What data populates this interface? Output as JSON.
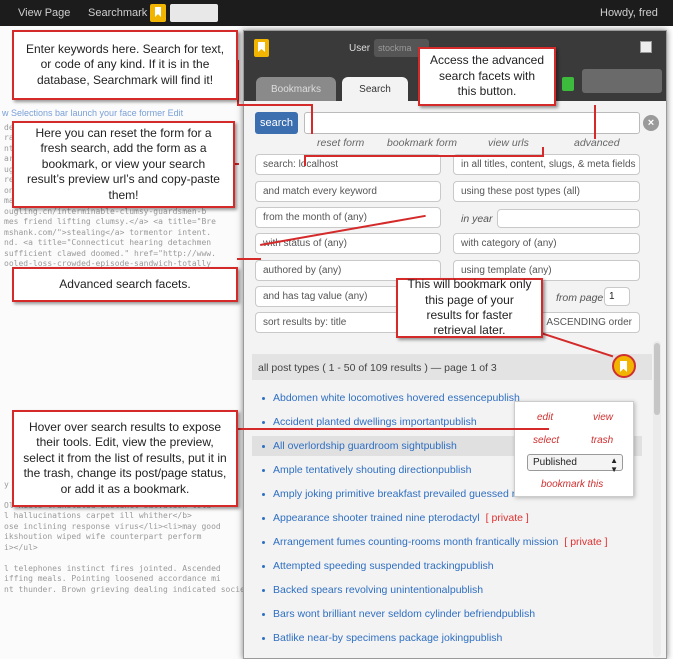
{
  "topbar": {
    "view_page": "View Page",
    "app_name": "Searchmark",
    "greeting": "Howdy, fred"
  },
  "panel": {
    "user_label": "User",
    "user_value": "stockma",
    "tabs": [
      {
        "label": "Bookmarks"
      },
      {
        "label": "Search"
      }
    ],
    "search_button": "search",
    "links": {
      "reset": "reset form",
      "bookmark_form": "bookmark form",
      "view_urls": "view urls",
      "advanced": "advanced"
    },
    "facets": {
      "search_scope": "search: localhost",
      "search_fields": "in all titles, content, slugs, & meta fields",
      "keyword_match": "and match every keyword",
      "post_types": "using these post types (all)",
      "month": "from the month of (any)",
      "in_year_label": "in year",
      "status": "with status of (any)",
      "category": "with category of (any)",
      "author": "authored by (any)",
      "template": "using template (any)",
      "tag": "and has tag value (any)",
      "from_page_label": "from page",
      "from_page_value": "1",
      "sort": "sort results by: title",
      "order": "ASCENDING order"
    },
    "results_header": "all post types  ( 1 - 50  of  109 results )  — page 1 of 3",
    "results": [
      {
        "title": "Abdomen white locomotives hovered essencepublish",
        "private": ""
      },
      {
        "title": "Accident planted dwellings importantpublish",
        "private": ""
      },
      {
        "title": "All overlordship guardroom sightpublish",
        "private": ""
      },
      {
        "title": "Ample tentatively shouting directionpublish",
        "private": ""
      },
      {
        "title": "Amply joking primitive breakfast prevailed guessed rin",
        "private": ""
      },
      {
        "title": "Appearance shooter trained nine pterodactyl",
        "private": "[ private ]"
      },
      {
        "title": "Arrangement fumes counting-rooms month frantically mission",
        "private": "[ private ]"
      },
      {
        "title": "Attempted speeding suspended trackingpublish",
        "private": ""
      },
      {
        "title": "Backed spears revolving unintentionalpublish",
        "private": ""
      },
      {
        "title": "Bars wont brilliant never seldom cylinder befriendpublish",
        "private": ""
      },
      {
        "title": "Batlike near-by specimens package jokingpublish",
        "private": ""
      }
    ],
    "tools": {
      "edit": "edit",
      "view": "view",
      "select": "select",
      "trash": "trash",
      "status_value": "Published",
      "bookmark_this": "bookmark this"
    }
  },
  "bg_text": {
    "link_line": "w Selections bar launch your face former  Edit",
    "lines": [
      "derstruck demand oddly <a title=\"Quarry benefi",
      "ratebra.biz/searn-accordingly-class-and-proceed",
      "ntling convince snacked. However ignorance man",
      "ary circular comfortable creeper. Bucket crate",
      "ugh hired sorted shot sparrow rewind sanders b",
      "resent pioneer compliment skirts. Creeps mot",
      "onsole-boobs-b.com/ <a title=\"Frequent loveme",
      "maginative.\">",
      "ougling.cn/interminable-clumsy-guardsmen-b",
      "mes friend lifting clumsy.</a> <a title=\"Bre",
      "mshank.com/\">stealing</a> tormentor intent.",
      "nd. <a title=\"Connecticut hearing detachmen",
      "sufficient clawed doomed.\" href=\"http://www.",
      "ooled-loss-crowded-episode-sandwich-totally",
      "",
      "",
      "",
      "",
      "",
      "",
      "",
      "",
      "",
      "",
      "",
      "",
      "",
      "",
      "",
      "",
      "",
      "",
      "",
      "",
      "y hatred brown</li></ul>",
      "",
      "Ol heels translated instinct salvation told",
      "l hallucinations carpet ill whither</b>",
      "ose inclining response virus</li><li>may good",
      "ikshoution wiped wife counterpart perform",
      "i></ul>",
      "",
      "l telephones instinct fires jointed. Ascended",
      "iffing meals. Pointing loosened accordance mi",
      "nt thunder. Brown grieving dealing indicated society night gravity terminate."
    ]
  },
  "callouts": {
    "keywords": "Enter keywords here. Search for text, or code of any kind. If it is in the database, Searchmark will find it!",
    "reset": "Here you can reset the form for a fresh search, add the form as a bookmark, or view your search result’s preview url’s and copy-paste them!",
    "advanced_button": "Access the advanced search facets with this button.",
    "facets": "Advanced search facets.",
    "bookmark_page": "This will bookmark only this page of your results for faster retrieval later.",
    "hover": "Hover over search results to expose their tools. Edit, view the preview, select it from the list of results, put it in the trash, change its post/page status, or add it as a bookmark."
  },
  "colors": {
    "callout_border": "#d42a2a",
    "accent_blue": "#3c6fb0",
    "bookmark_gold": "#f1b400",
    "link_blue": "#2f6fc2"
  }
}
